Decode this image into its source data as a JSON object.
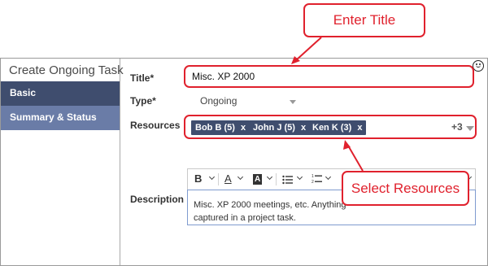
{
  "sidebar": {
    "title": "Create Ongoing Task",
    "items": [
      {
        "label": "Basic"
      },
      {
        "label": "Summary & Status"
      }
    ]
  },
  "form": {
    "title_label": "Title*",
    "title_value": "Misc. XP 2000",
    "type_label": "Type*",
    "type_value": "Ongoing",
    "resources_label": "Resources",
    "resources": [
      "Bob B (5)",
      "John J (5)",
      "Ken K (3)"
    ],
    "remove_glyph": "x",
    "resources_more": "+3",
    "description_label": "Description",
    "description_line1": "Misc. XP 2000 meetings, etc. Anything",
    "description_line2": "captured in a project task."
  },
  "toolbar": {
    "bold": "B",
    "text_color": "A",
    "highlight": "A"
  },
  "callouts": {
    "enter_title": "Enter Title",
    "select_resources": "Select Resources"
  },
  "colors": {
    "accent_red": "#e0212d",
    "nav_dark": "#3f4d6e",
    "nav_light": "#6a7ca7",
    "tag_bg": "#3f4d6e"
  },
  "icons": {
    "feedback": "smiley-icon",
    "dropdown": "caret-down-icon"
  }
}
